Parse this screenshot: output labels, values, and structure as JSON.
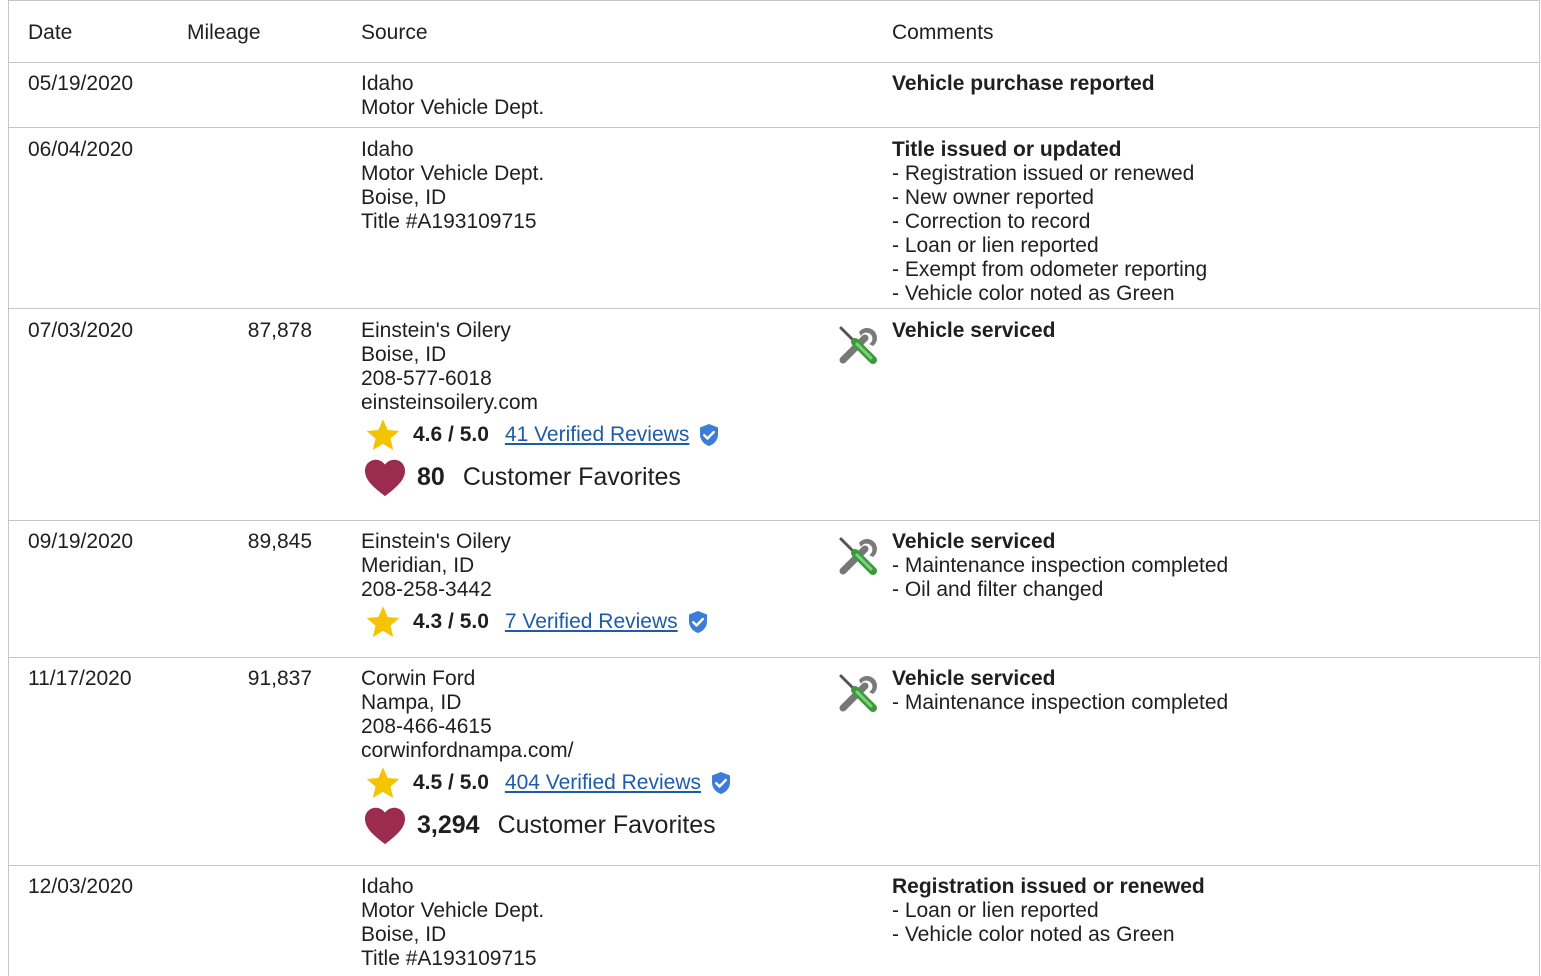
{
  "columns": {
    "date": "Date",
    "mileage": "Mileage",
    "source": "Source",
    "comments": "Comments"
  },
  "rows": [
    {
      "date": "05/19/2020",
      "mileage": "",
      "source": [
        "Idaho",
        "Motor Vehicle Dept."
      ],
      "comment_title": "Vehicle purchase reported",
      "comment_items": [],
      "service_icon": false
    },
    {
      "date": "06/04/2020",
      "mileage": "",
      "source": [
        "Idaho",
        "Motor Vehicle Dept.",
        "Boise, ID",
        "Title #A193109715"
      ],
      "comment_title": "Title issued or updated",
      "comment_items": [
        "- Registration issued or renewed",
        "- New owner reported",
        "- Correction to record",
        "- Loan or lien reported",
        "- Exempt from odometer reporting",
        "- Vehicle color noted as Green"
      ],
      "service_icon": false
    },
    {
      "date": "07/03/2020",
      "mileage": "87,878",
      "source": [
        "Einstein's Oilery",
        "Boise, ID",
        "208-577-6018",
        "einsteinsoilery.com"
      ],
      "rating": "4.6 / 5.0",
      "reviews": "41 Verified Reviews",
      "favorites_count": "80",
      "favorites_label": "Customer Favorites",
      "comment_title": "Vehicle serviced",
      "comment_items": [],
      "service_icon": true
    },
    {
      "date": "09/19/2020",
      "mileage": "89,845",
      "source": [
        "Einstein's Oilery",
        "Meridian, ID",
        "208-258-3442"
      ],
      "rating": "4.3 / 5.0",
      "reviews": "7 Verified Reviews",
      "comment_title": "Vehicle serviced",
      "comment_items": [
        "- Maintenance inspection completed",
        "- Oil and filter changed"
      ],
      "service_icon": true
    },
    {
      "date": "11/17/2020",
      "mileage": "91,837",
      "source": [
        "Corwin Ford",
        "Nampa, ID",
        "208-466-4615",
        "corwinfordnampa.com/"
      ],
      "rating": "4.5 / 5.0",
      "reviews": "404 Verified Reviews",
      "favorites_count": "3,294",
      "favorites_label": "Customer Favorites",
      "comment_title": "Vehicle serviced",
      "comment_items": [
        "- Maintenance inspection completed"
      ],
      "service_icon": true
    },
    {
      "date": "12/03/2020",
      "mileage": "",
      "source": [
        "Idaho",
        "Motor Vehicle Dept.",
        "Boise, ID",
        "Title #A193109715"
      ],
      "comment_title": "Registration issued or renewed",
      "comment_items": [
        "- Loan or lien reported",
        "- Vehicle color noted as Green"
      ],
      "service_icon": false
    }
  ],
  "colors": {
    "star": "#f5c400",
    "heart": "#9b2c4f",
    "link": "#1e5ba8",
    "verified": "#3b7dd8",
    "border": "#c7c7c7"
  },
  "icons": {
    "star": "star-icon",
    "heart": "heart-icon",
    "verified": "verified-check-icon",
    "service": "wrench-screwdriver-icon"
  }
}
